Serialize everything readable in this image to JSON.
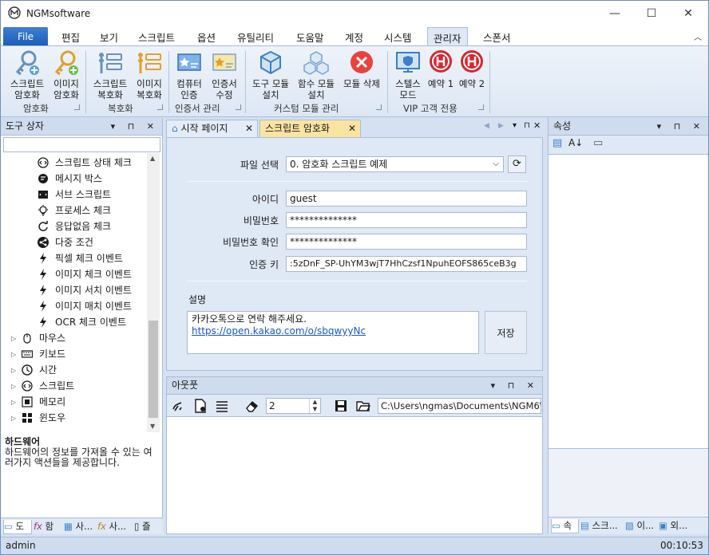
{
  "window": {
    "title": "NGMsoftware",
    "minimize": "—",
    "maximize": "☐",
    "close": "✕"
  },
  "menu": {
    "file": "File",
    "tabs": [
      "편집",
      "보기",
      "스크립트",
      "옵션",
      "유틸리티",
      "도움말",
      "계정",
      "시스템",
      "관리자",
      "스폰서"
    ],
    "active_tab": "관리자",
    "collapse": "︿"
  },
  "ribbon": {
    "groups": [
      {
        "label": "암호화",
        "buttons": [
          "스크립트\n암호화",
          "이미지\n암호화"
        ]
      },
      {
        "label": "복호화",
        "buttons": [
          "스크립트\n복호화",
          "이미지\n복호화"
        ]
      },
      {
        "label": "인증서 관리",
        "buttons": [
          "컴퓨터\n인증",
          "인증서\n수정"
        ]
      },
      {
        "label": "커스텀 모듈 관리",
        "buttons": [
          "도구 모듈\n설치",
          "함수 모듈\n설치",
          "모듈 삭제"
        ]
      },
      {
        "label": "VIP 고객 전용",
        "buttons": [
          "스텔스\n모드",
          "예약 1",
          "예약 2"
        ]
      }
    ]
  },
  "toolbox": {
    "title": "도구 상자",
    "search_value": "",
    "items": [
      {
        "label": "스크립트 상태 체크",
        "icon": "code-circle-icon",
        "level": 2
      },
      {
        "label": "메시지 박스",
        "icon": "message-icon",
        "level": 2
      },
      {
        "label": "서브 스크립트",
        "icon": "subscript-icon",
        "level": 2
      },
      {
        "label": "프로세스 체크",
        "icon": "bulb-icon",
        "level": 2
      },
      {
        "label": "응답없음 체크",
        "icon": "refresh-icon",
        "level": 2
      },
      {
        "label": "다중 조건",
        "icon": "share-icon",
        "level": 2
      },
      {
        "label": "픽셀 체크 이벤트",
        "icon": "bolt-icon",
        "level": 2
      },
      {
        "label": "이미지 체크 이벤트",
        "icon": "bolt-icon",
        "level": 2
      },
      {
        "label": "이미지 서치 이벤트",
        "icon": "bolt-icon",
        "level": 2
      },
      {
        "label": "이미지 매치 이벤트",
        "icon": "bolt-icon",
        "level": 2
      },
      {
        "label": "OCR 체크 이벤트",
        "icon": "bolt-icon",
        "level": 2
      },
      {
        "label": "마우스",
        "icon": "mouse-icon",
        "level": 1
      },
      {
        "label": "키보드",
        "icon": "keyboard-icon",
        "level": 1
      },
      {
        "label": "시간",
        "icon": "clock-icon",
        "level": 1
      },
      {
        "label": "스크립트",
        "icon": "code-circle-icon",
        "level": 1
      },
      {
        "label": "메모리",
        "icon": "memory-icon",
        "level": 1
      },
      {
        "label": "윈도우",
        "icon": "windows-icon",
        "level": 1
      }
    ],
    "info_title": "하드웨어",
    "info_desc": "하드웨어의 정보를 가져올 수 있는 여러가지 액션들을 제공합니다.",
    "bottom_tabs": [
      "도",
      "함",
      "사...",
      "사...",
      "즐"
    ]
  },
  "document": {
    "tabs": [
      {
        "label": "시작 페이지",
        "active": false
      },
      {
        "label": "스크립트 암호화",
        "active": true
      }
    ],
    "labels": {
      "file_select": "파일 선택",
      "id": "아이디",
      "password": "비밀번호",
      "password_confirm": "비밀번호 확인",
      "auth_key": "인증 키",
      "description": "설명"
    },
    "file_select_value": "0. 암호화 스크립트 예제",
    "id_value": "guest",
    "password_value": "**************",
    "password_confirm_value": "**************",
    "auth_key_value": ":5zDnF_SP-UhYM3wjT7HhCzsf1NpuhEOFS865ceB3g",
    "description_line1": "카카오톡으로 연락 해주세요.",
    "description_link": "https://open.kakao.com/o/sbqwyyNc",
    "save_label": "저장"
  },
  "output": {
    "title": "아웃풋",
    "stepper_value": "2",
    "path_value": "C:\\Users\\ngmas\\Documents\\NGM6\\"
  },
  "properties": {
    "title": "속성",
    "bottom_tabs": [
      "속",
      "스크...",
      "이...",
      "외..."
    ]
  },
  "status": {
    "user": "admin",
    "time": "00:10:53"
  }
}
